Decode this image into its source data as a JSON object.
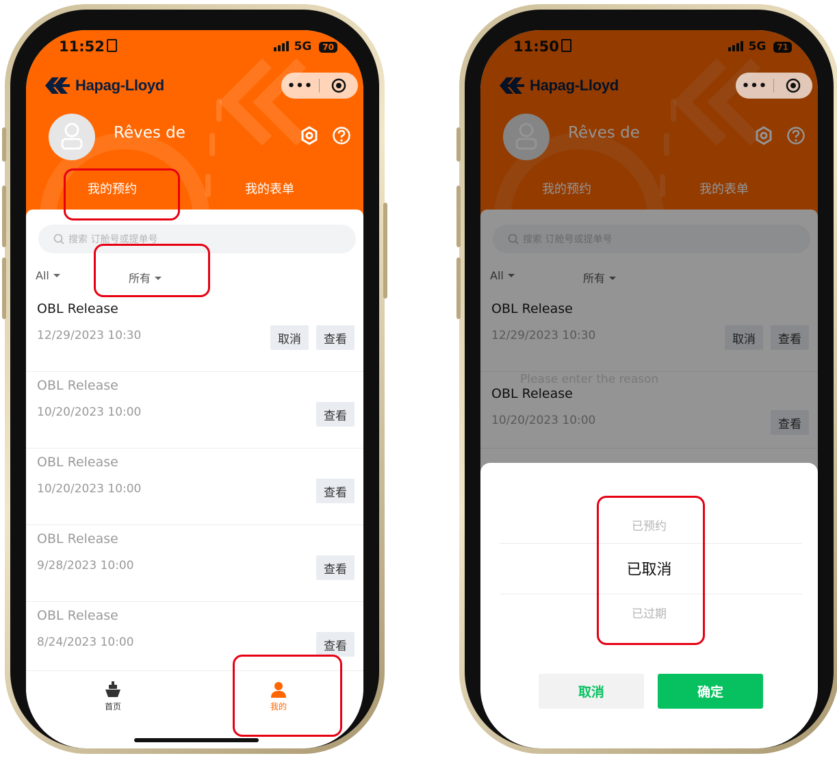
{
  "left": {
    "status": {
      "time": "11:52",
      "network": "5G",
      "battery": "70"
    },
    "brand": {
      "name": "Hapag-Lloyd"
    },
    "capsule": {
      "more": "•••"
    },
    "user": {
      "name": "Rêves de"
    },
    "tabs": [
      {
        "label": "我的预约"
      },
      {
        "label": "我的表单"
      }
    ],
    "search": {
      "placeholder": "搜索 订舱号或提单号"
    },
    "filters": {
      "type": "All",
      "status": "所有"
    },
    "items": [
      {
        "title": "OBL Release",
        "date": "12/29/2023 10:30",
        "cancel_label": "取消",
        "view_label": "查看"
      },
      {
        "title": "OBL Release",
        "date": "10/20/2023 10:00",
        "view_label": "查看"
      },
      {
        "title": "OBL Release",
        "date": "10/20/2023 10:00",
        "view_label": "查看"
      },
      {
        "title": "OBL Release",
        "date": "9/28/2023 10:00",
        "view_label": "查看"
      },
      {
        "title": "OBL Release",
        "date": "8/24/2023 10:00",
        "view_label": "查看"
      }
    ],
    "tabbar": {
      "home": "首页",
      "mine": "我的"
    }
  },
  "right": {
    "status": {
      "time": "11:50",
      "network": "5G",
      "battery": "71"
    },
    "brand": {
      "name": "Hapag-Lloyd"
    },
    "capsule": {
      "more": "•••"
    },
    "user": {
      "name": "Rêves de"
    },
    "tabs": [
      {
        "label": "我的预约"
      },
      {
        "label": "我的表单"
      }
    ],
    "search": {
      "placeholder": "搜索 订舱号或提单号"
    },
    "filters": {
      "type": "All",
      "status": "所有"
    },
    "items": [
      {
        "title": "OBL Release",
        "date": "12/29/2023 10:30",
        "cancel_label": "取消",
        "view_label": "查看"
      },
      {
        "title": "OBL Release",
        "date": "10/20/2023 10:00",
        "view_label": "查看"
      }
    ],
    "reason_placeholder": "Please enter the reason",
    "picker": {
      "options": [
        "已预约",
        "已取消",
        "已过期"
      ],
      "cancel_label": "取消",
      "confirm_label": "确定"
    }
  },
  "colors": {
    "brand_orange": "#ff6600",
    "confirm_green": "#07c160",
    "highlight_red": "#e60012",
    "logo_navy": "#0a1e3f"
  }
}
